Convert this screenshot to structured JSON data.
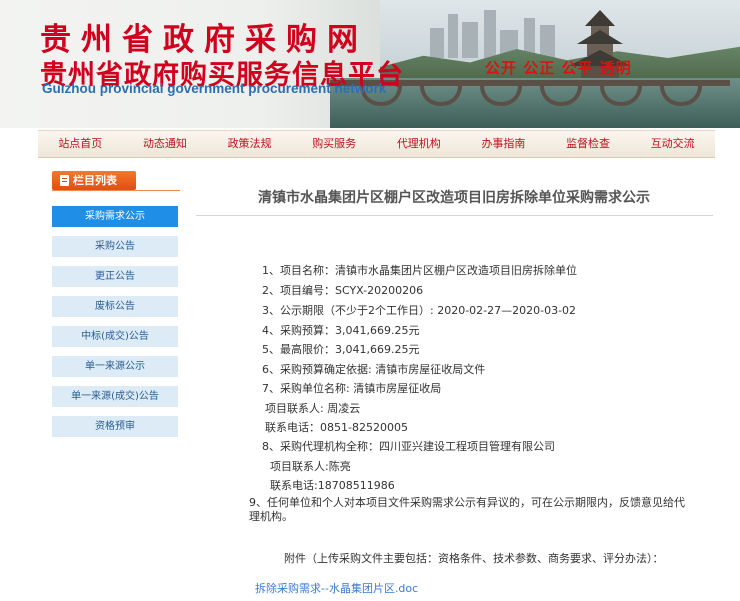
{
  "header": {
    "title_main": "贵州省政府采购网",
    "title_sub": "贵州省政府购买服务信息平台",
    "title_en": "Guizhou provincial government procurement network",
    "slogan": "公开 公正 公平 透明"
  },
  "nav": {
    "items": [
      "站点首页",
      "动态通知",
      "政策法规",
      "购买服务",
      "代理机构",
      "办事指南",
      "监督检查",
      "互动交流"
    ]
  },
  "sidebar": {
    "heading": "栏目列表",
    "items": [
      "采购需求公示",
      "采购公告",
      "更正公告",
      "废标公告",
      "中标(成交)公告",
      "单一来源公示",
      "单一来源(成交)公告",
      "资格预审"
    ],
    "active_index": 0
  },
  "article": {
    "title": "清镇市水晶集团片区棚户区改造项目旧房拆除单位采购需求公示",
    "rows": [
      "1、项目名称：清镇市水晶集团片区棚户区改造项目旧房拆除单位",
      "2、项目编号：SCYX-20200206",
      "3、公示期限（不少于2个工作日）: 2020-02-27—2020-03-02",
      "4、采购预算：3,041,669.25元",
      "5、最高限价：3,041,669.25元",
      "6、采购预算确定依据:        清镇市房屋征收局文件",
      "7、采购单位名称: 清镇市房屋征收局",
      "项目联系人: 周凌云",
      "联系电话：0851-82520005",
      "8、采购代理机构全称：四川亚兴建设工程项目管理有限公司",
      "项目联系人:陈亮",
      "联系电话:18708511986"
    ],
    "note": "9、任何单位和个人对本项目文件采购需求公示有异议的，可在公示期限内，反馈意见给代理机构。",
    "attachment_label": "附件（上传采购文件主要包括：资格条件、技术参数、商务要求、评分办法）：",
    "file_link": "拆除采购需求--水晶集团片区.doc"
  },
  "colors": {
    "title_red": "#d1001c",
    "english_blue": "#2b6fb0",
    "nav_text": "#c0101c",
    "sidebar_active": "#1e8ee6",
    "sidebar_item": "#dcebf6",
    "heading_orange": "#e04e12",
    "link_blue": "#3a7bd5"
  }
}
